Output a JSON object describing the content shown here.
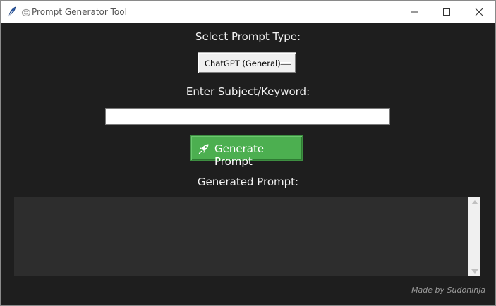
{
  "window": {
    "title": "Prompt Generator Tool",
    "app_icon": "feather-icon",
    "title_icon": "brain-icon",
    "controls": [
      "minimize-icon",
      "maximize-icon",
      "close-icon"
    ]
  },
  "form": {
    "prompt_type_label": "Select Prompt Type:",
    "prompt_type_selected": "ChatGPT (General)",
    "subject_label": "Enter Subject/Keyword:",
    "subject_value": "",
    "generate_button_label": "Generate Prompt",
    "generate_button_icon": "rocket-icon",
    "output_label": "Generated Prompt:",
    "output_value": ""
  },
  "footer": {
    "credit": "Made by Sudoninja"
  },
  "colors": {
    "background": "#1e1e1e",
    "button_green": "#4caf50",
    "text": "#f2f2f2",
    "output_bg": "#2d2d2d"
  }
}
